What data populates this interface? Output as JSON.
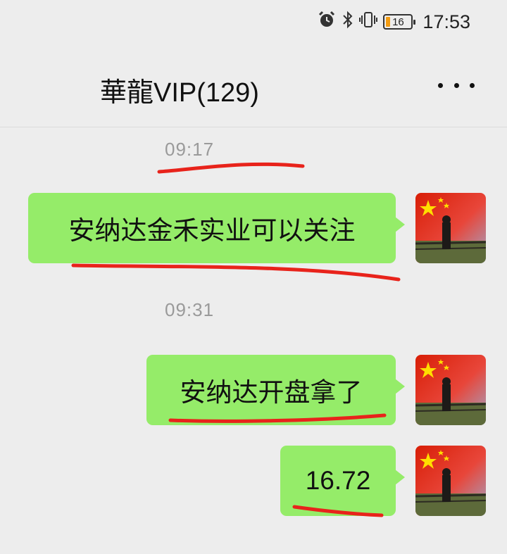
{
  "status_bar": {
    "time": "17:53",
    "battery_level": "16",
    "icons": [
      "alarm-icon",
      "bluetooth-icon",
      "vibrate-icon",
      "battery-icon"
    ]
  },
  "header": {
    "title": "華龍VIP(129)",
    "more_icon": "more-dots-icon"
  },
  "messages": [
    {
      "timestamp": "09:17",
      "text": "安纳达金禾实业可以关注",
      "sender": "self"
    },
    {
      "timestamp": "09:31",
      "text": "安纳达开盘拿了",
      "sender": "self"
    },
    {
      "text": "16.72",
      "sender": "self"
    }
  ],
  "colors": {
    "background": "#ededed",
    "bubble": "#95ec69",
    "annotation": "#e8231b"
  }
}
